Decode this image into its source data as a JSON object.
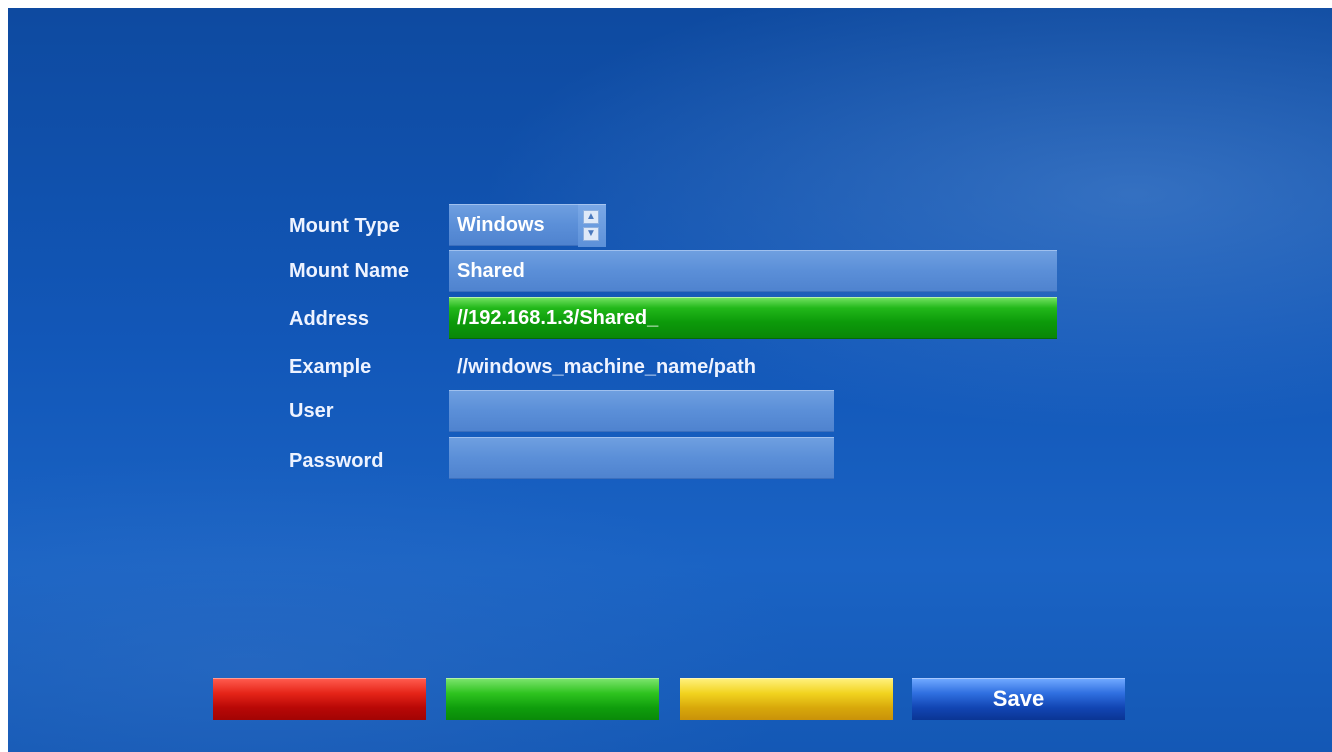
{
  "form": {
    "mount_type": {
      "label": "Mount Type",
      "value": "Windows"
    },
    "mount_name": {
      "label": "Mount Name",
      "value": "Shared"
    },
    "address": {
      "label": "Address",
      "value": "//192.168.1.3/Shared_"
    },
    "example": {
      "label": "Example",
      "value": "//windows_machine_name/path"
    },
    "user": {
      "label": "User",
      "value": ""
    },
    "password": {
      "label": "Password",
      "value": ""
    }
  },
  "buttons": {
    "red_label": "",
    "green_label": "",
    "yellow_label": "",
    "save_label": "Save"
  },
  "colors": {
    "background": "#1257b8",
    "field": "#5b8fd8",
    "active_field": "#0c9a0a",
    "red": "#b80806",
    "green": "#0f9e0c",
    "yellow": "#d8a80b",
    "blue": "#1245b3"
  },
  "icons": {
    "spinner_up": "chevron-up-icon",
    "spinner_down": "chevron-down-icon"
  }
}
